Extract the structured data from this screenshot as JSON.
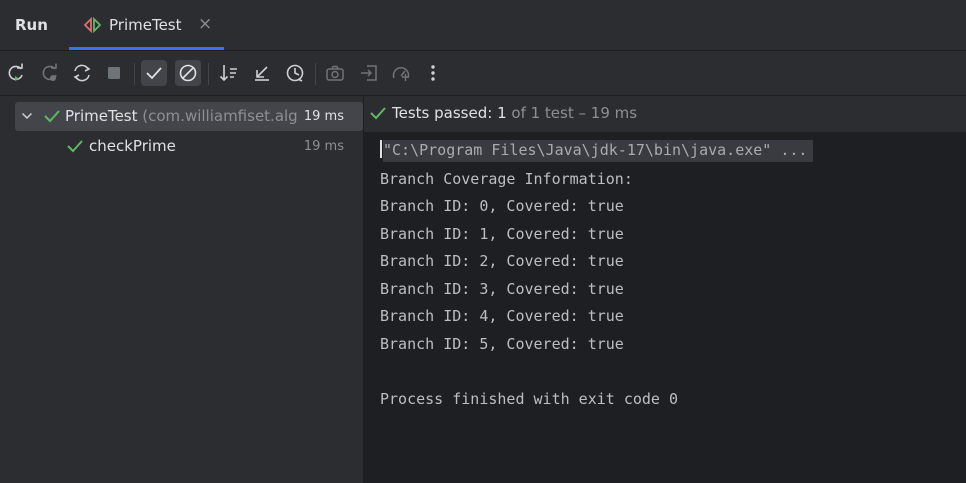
{
  "header": {
    "title": "Run",
    "tab": {
      "label": "PrimeTest",
      "close": "×"
    }
  },
  "toolbar": {
    "buttons": [
      "rerun-icon",
      "rerun-failed-icon",
      "toggle-auto-test-icon",
      "stop-icon",
      "show-passed-icon",
      "show-ignored-icon",
      "sort-icon",
      "collapse-icon",
      "history-icon",
      "screenshot-icon",
      "import-icon",
      "coverage-icon",
      "more-icon"
    ]
  },
  "tree": {
    "items": [
      {
        "label": "PrimeTest",
        "package": "(com.williamfiset.alg",
        "time": "19 ms"
      },
      {
        "label": "checkPrime",
        "time": "19 ms"
      }
    ]
  },
  "status": {
    "passed_label": "Tests passed:",
    "passed_count": "1",
    "of_total": "of 1 test",
    "duration": "– 19 ms"
  },
  "console": {
    "command": "\"C:\\Program Files\\Java\\jdk-17\\bin\\java.exe\" ...",
    "lines": [
      "Branch Coverage Information:",
      "Branch ID: 0, Covered: true",
      "Branch ID: 1, Covered: true",
      "Branch ID: 2, Covered: true",
      "Branch ID: 3, Covered: true",
      "Branch ID: 4, Covered: true",
      "Branch ID: 5, Covered: true"
    ],
    "finish": "Process finished with exit code 0"
  },
  "colors": {
    "accent": "#3574f0",
    "pass": "#5fb865",
    "bg": "#2b2d30",
    "console_bg": "#1e1f22"
  }
}
